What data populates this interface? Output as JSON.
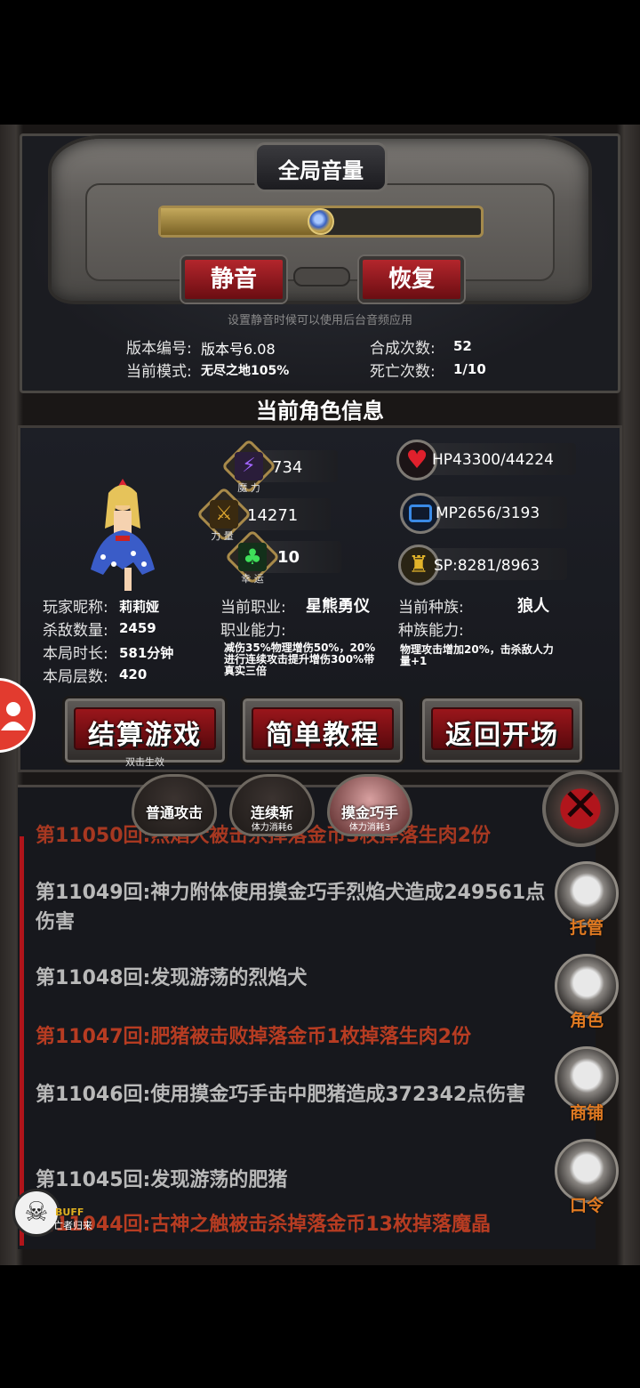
{
  "settings": {
    "title": "全局音量",
    "volume_level": 0.5,
    "mute_label": "静音",
    "restore_label": "恢复",
    "hint": "设置静音时候可以使用后台音频应用",
    "version_label": "版本编号:",
    "version_value": "版本号6.08",
    "mode_label": "当前模式:",
    "mode_value": "无尽之地105%",
    "craft_label": "合成次数:",
    "craft_value": "52",
    "death_label": "死亡次数:",
    "death_value": "1/10"
  },
  "character": {
    "header": "当前角色信息",
    "stats": {
      "magic_caption": "魔 力",
      "magic_value": "734",
      "power_caption": "力 量",
      "power_value": "14271",
      "luck_caption": "幸 运",
      "luck_value": "10"
    },
    "resources": {
      "hp": "HP43300/44224",
      "mp": "MP2656/3193",
      "sp": "SP:8281/8963"
    },
    "nickname_label": "玩家昵称:",
    "nickname_value": "莉莉娅",
    "kills_label": "杀敌数量:",
    "kills_value": "2459",
    "time_label": "本局时长:",
    "time_value": "581分钟",
    "floor_label": "本局层数:",
    "floor_value": "420",
    "job_label": "当前职业:",
    "job_value": "星熊勇仪",
    "job_ability_label": "职业能力:",
    "job_ability_text": "减伤35%物理增伤50%，20%进行连续攻击提升增伤300%带真实三倍",
    "race_label": "当前种族:",
    "race_value": "狼人",
    "race_ability_label": "种族能力:",
    "race_ability_text": "物理攻击增加20%，击杀敌人力量+1"
  },
  "actions": {
    "settle_label": "结算游戏",
    "settle_sub": "双击生效",
    "tutorial_label": "简单教程",
    "return_label": "返回开场"
  },
  "skills": [
    {
      "name": "普通攻击",
      "sub": ""
    },
    {
      "name": "连续斩",
      "sub": "体力消耗6"
    },
    {
      "name": "摸金巧手",
      "sub": "体力消耗3"
    }
  ],
  "log": [
    {
      "text": "第11050回:烈焰犬被击杀掉落金币3枚掉落生肉2份",
      "color": "red"
    },
    {
      "text": "第11049回:神力附体使用摸金巧手烈焰犬造成249561点伤害",
      "color": "grey"
    },
    {
      "text": "第11048回:发现游荡的烈焰犬",
      "color": "grey"
    },
    {
      "text": "第11047回:肥猪被击败掉落金币1枚掉落生肉2份",
      "color": "red"
    },
    {
      "text": "第11046回:使用摸金巧手击中肥猪造成372342点伤害",
      "color": "grey"
    },
    {
      "text": "第11045回:发现游荡的肥猪",
      "color": "grey"
    },
    {
      "text": "第11044回:古神之触被击杀掉落金币13枚掉落魔晶",
      "color": "red"
    }
  ],
  "side_menu": {
    "auto_label": "托管",
    "role_label": "角色",
    "shop_label": "商铺",
    "code_label": "口令"
  },
  "buff": {
    "title": "BUFF",
    "name": "亡者归来"
  },
  "colors": {
    "accent_red": "#b0141a",
    "log_red": "#b73c22",
    "menu_orange": "#e07a22",
    "gold": "#c4a95c"
  }
}
